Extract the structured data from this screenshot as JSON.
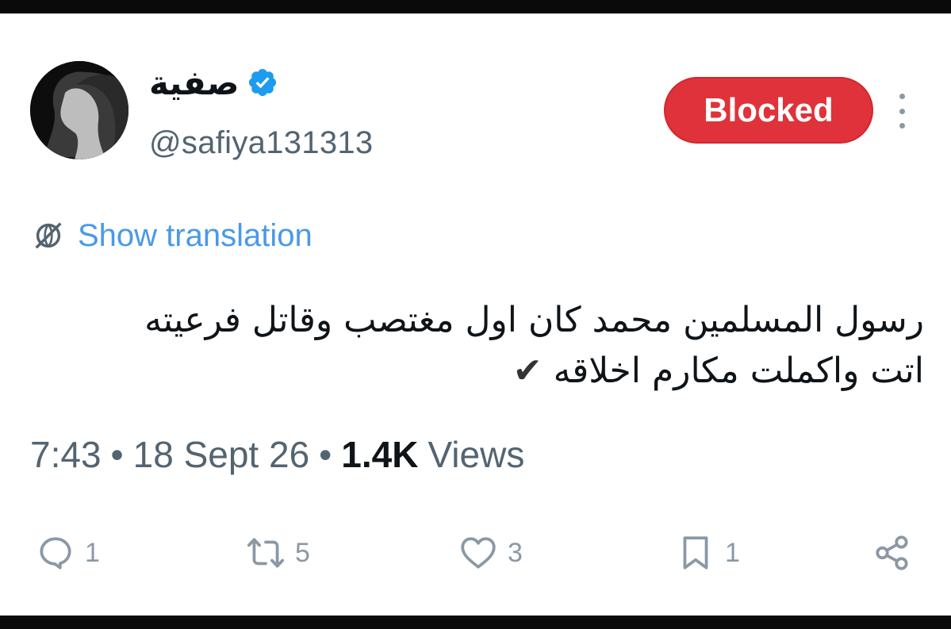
{
  "tweet": {
    "display_name": "صفية",
    "verified_icon": "verified-badge-icon",
    "handle": "@safiya131313",
    "blocked_label": "Blocked",
    "translation_label": "Show translation",
    "text_line1": "رسول المسلمين محمد كان اول مغتصب وقاتل فرعيته",
    "text_line2": "اتت واكملت مكارم اخلاقه",
    "text_emoji": "✔",
    "time": "7:43",
    "date": "18 Sept 26",
    "separator": "•",
    "views_count": "1.4K",
    "views_label": "Views"
  },
  "actions": {
    "reply_count": "1",
    "retweet_count": "5",
    "like_count": "3",
    "bookmark_count": "1"
  },
  "colors": {
    "blocked_bg": "#e0323a",
    "link_blue": "#4a99e9",
    "muted_gray": "#536471",
    "icon_gray": "#8b98a5",
    "verified_blue": "#1d9bf0"
  }
}
